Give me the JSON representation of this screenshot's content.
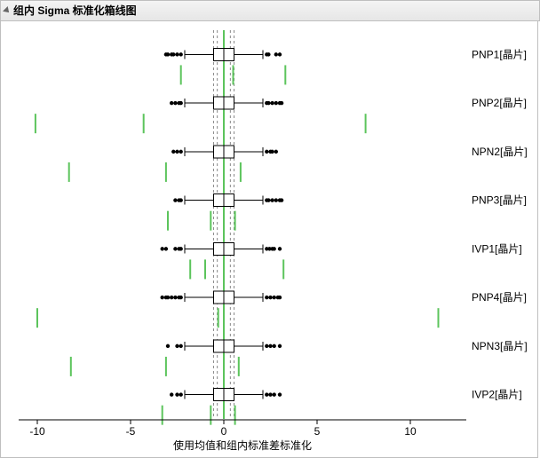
{
  "title": "组内 Sigma 标准化箱线图",
  "xlabel": "使用均值和组内标准差标准化",
  "chart_data": {
    "type": "boxplot",
    "orientation": "horizontal",
    "xlim": [
      -11,
      13
    ],
    "x_ticks": [
      -10,
      -5,
      0,
      5,
      10
    ],
    "ref_lines": {
      "solid": [
        0
      ],
      "dashed": [
        -0.55,
        -0.35,
        0.35,
        0.55
      ]
    },
    "point_radius": 2.2,
    "rows": [
      {
        "label": "PNP1[晶片]",
        "box": {
          "q1": -0.55,
          "median": 0.0,
          "q3": 0.55,
          "whisker_low": -2.1,
          "whisker_high": 2.1
        },
        "outliers": [
          -3.1,
          -3.0,
          -2.8,
          -2.7,
          -2.5,
          -2.3,
          2.3,
          2.4,
          2.8,
          3.0
        ],
        "sparks": [
          -2.3,
          0.5,
          3.3
        ]
      },
      {
        "label": "PNP2[晶片]",
        "box": {
          "q1": -0.55,
          "median": 0.0,
          "q3": 0.55,
          "whisker_low": -2.1,
          "whisker_high": 2.1
        },
        "outliers": [
          -2.8,
          -2.6,
          -2.4,
          -2.3,
          2.3,
          2.4,
          2.6,
          2.8,
          3.0,
          3.1
        ],
        "sparks": [
          -10.1,
          -4.3,
          7.6
        ]
      },
      {
        "label": "NPN2[晶片]",
        "box": {
          "q1": -0.55,
          "median": 0.0,
          "q3": 0.55,
          "whisker_low": -2.1,
          "whisker_high": 2.1
        },
        "outliers": [
          -2.7,
          -2.5,
          -2.3,
          2.3,
          2.5,
          2.6,
          2.8
        ],
        "sparks": [
          -8.3,
          -3.1,
          0.9
        ]
      },
      {
        "label": "PNP3[晶片]",
        "box": {
          "q1": -0.55,
          "median": 0.0,
          "q3": 0.55,
          "whisker_low": -2.1,
          "whisker_high": 2.1
        },
        "outliers": [
          -2.6,
          -2.4,
          -2.3,
          2.3,
          2.4,
          2.6,
          2.8,
          3.0,
          3.1
        ],
        "sparks": [
          -3.0,
          -0.7,
          0.6
        ]
      },
      {
        "label": "IVP1[晶片]",
        "box": {
          "q1": -0.55,
          "median": 0.0,
          "q3": 0.55,
          "whisker_low": -2.1,
          "whisker_high": 2.1
        },
        "outliers": [
          -3.3,
          -3.1,
          -2.6,
          -2.4,
          -2.3,
          2.3,
          2.45,
          2.6,
          2.7,
          3.0
        ],
        "sparks": [
          -1.8,
          -1.0,
          3.2
        ]
      },
      {
        "label": "PNP4[晶片]",
        "box": {
          "q1": -0.55,
          "median": 0.0,
          "q3": 0.55,
          "whisker_low": -2.1,
          "whisker_high": 2.1
        },
        "outliers": [
          -3.3,
          -3.1,
          -3.0,
          -2.8,
          -2.6,
          -2.4,
          -2.3,
          2.3,
          2.5,
          2.7,
          2.9,
          3.0
        ],
        "sparks": [
          -10.0,
          -0.3,
          11.5
        ]
      },
      {
        "label": "NPN3[晶片]",
        "box": {
          "q1": -0.55,
          "median": 0.0,
          "q3": 0.55,
          "whisker_low": -2.1,
          "whisker_high": 2.1
        },
        "outliers": [
          -3.0,
          -2.5,
          -2.3,
          2.3,
          2.5,
          2.7,
          3.0
        ],
        "sparks": [
          -8.2,
          -3.1,
          0.8
        ]
      },
      {
        "label": "IVP2[晶片]",
        "box": {
          "q1": -0.55,
          "median": 0.0,
          "q3": 0.55,
          "whisker_low": -2.1,
          "whisker_high": 2.1
        },
        "outliers": [
          -2.8,
          -2.5,
          -2.3,
          2.3,
          2.5,
          2.7,
          3.0
        ],
        "sparks": [
          -3.3,
          -0.7,
          0.6
        ]
      }
    ]
  }
}
